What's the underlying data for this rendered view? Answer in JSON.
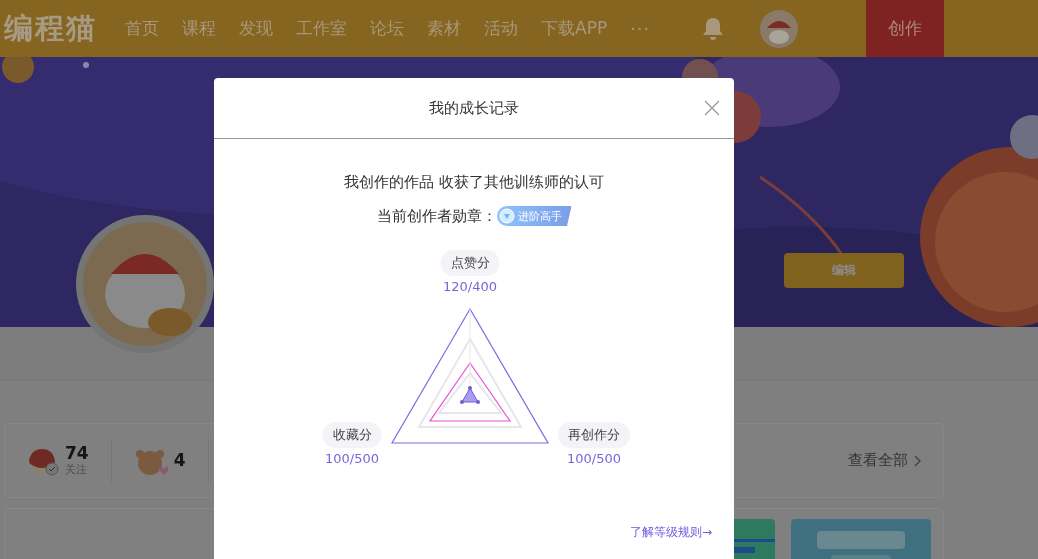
{
  "nav": {
    "logo": "编程猫",
    "items": [
      "首页",
      "课程",
      "发现",
      "工作室",
      "论坛",
      "素材",
      "活动",
      "下载APP"
    ],
    "more": "···",
    "create": "创作"
  },
  "profile": {
    "edit": "编辑"
  },
  "stats": [
    {
      "value": "74",
      "label": "关注"
    },
    {
      "value": "4"
    }
  ],
  "view_all": "查看全部",
  "dialog": {
    "title": "我的成长记录",
    "message": "我创作的作品 收获了其他训练师的认可",
    "badge_label": "当前创作者勋章：",
    "badge": "进阶高手",
    "axes": [
      {
        "label": "点赞分",
        "score": "120/400"
      },
      {
        "label": "收藏分",
        "score": "100/500"
      },
      {
        "label": "再创作分",
        "score": "100/500"
      }
    ],
    "rules_link": "了解等级规则→"
  }
}
